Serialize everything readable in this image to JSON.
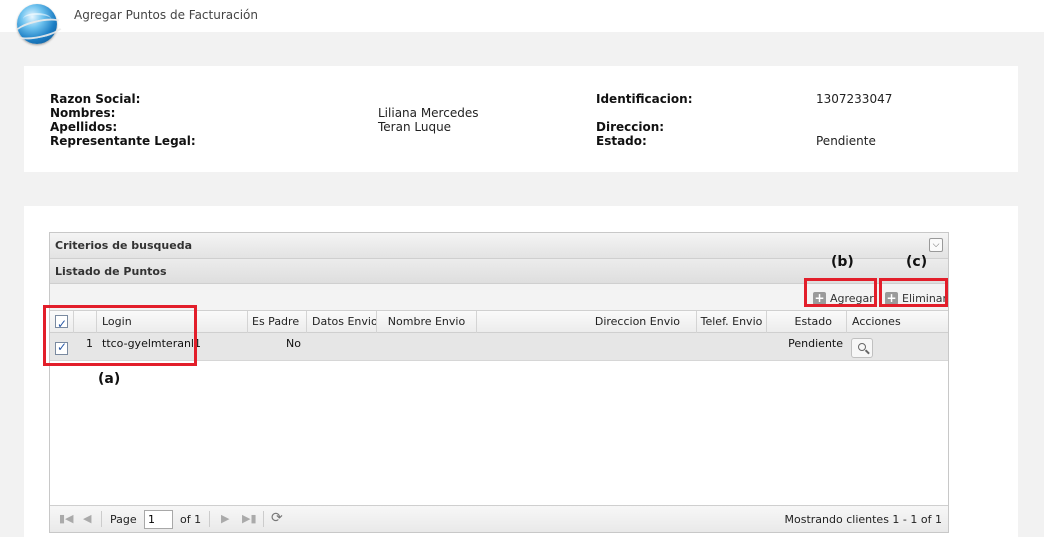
{
  "header": {
    "title": "Agregar Puntos de Facturación",
    "logo_icon": "globe-icon"
  },
  "client": {
    "razon_social_label": "Razon Social:",
    "nombres_label": "Nombres:",
    "nombres_value": "Liliana Mercedes",
    "apellidos_label": "Apellidos:",
    "apellidos_value": "Teran Luque",
    "representante_label": "Representante Legal:",
    "identificacion_label": "Identificacion:",
    "identificacion_value": "1307233047",
    "direccion_label": "Direccion:",
    "estado_label": "Estado:",
    "estado_value": "Pendiente"
  },
  "criteria": {
    "title": "Criterios de busqueda"
  },
  "list": {
    "title": "Listado de Puntos",
    "add_label": "Agregar",
    "delete_label": "Eliminar"
  },
  "columns": [
    "Login",
    "Es Padre",
    "Datos Envio",
    "Nombre Envio",
    "Direccion Envio",
    "Telef. Envio",
    "Estado",
    "Acciones"
  ],
  "rows": [
    {
      "number": "1",
      "login": "ttco-gyelmteranl1",
      "es_padre": "No",
      "estado": "Pendiente"
    }
  ],
  "pager": {
    "page_label": "Page",
    "page_value": "1",
    "of_label": "of 1",
    "summary": "Mostrando clientes 1 - 1 of 1"
  },
  "annotations": {
    "a": "(a)",
    "b": "(b)",
    "c": "(c)",
    "color": "#e21e2a"
  }
}
